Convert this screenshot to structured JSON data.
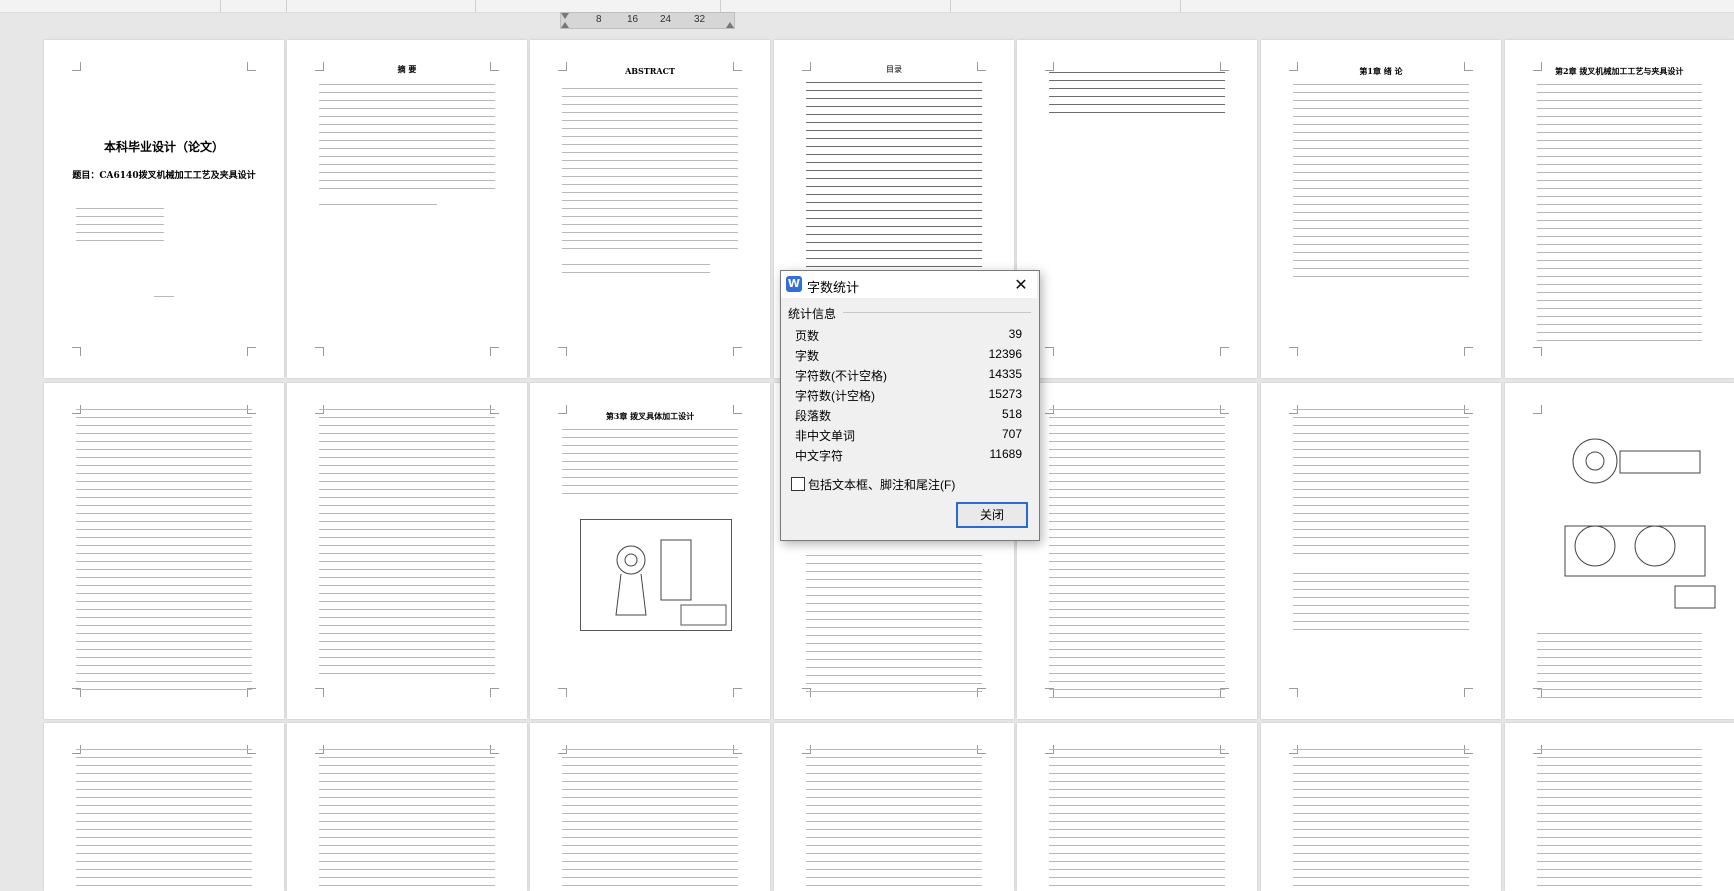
{
  "ruler": {
    "marks": [
      "8",
      "16",
      "24",
      "32"
    ]
  },
  "document": {
    "cover_title": "本科毕业设计（论文）",
    "cover_subject": "题目：CA6140拨叉机械加工工艺及夹具设计",
    "abstract_cn_title": "摘 要",
    "abstract_en_title": "ABSTRACT",
    "toc_title": "目录",
    "chapter1_title": "第1章 绪 论",
    "chapter2_title": "第2章 拨叉机械加工工艺与夹具设计",
    "chapter3_title": "第3章 拨叉具体加工设计"
  },
  "dialog": {
    "title": "字数统计",
    "section": "统计信息",
    "stats": [
      {
        "label": "页数",
        "value": "39"
      },
      {
        "label": "字数",
        "value": "12396"
      },
      {
        "label": "字符数(不计空格)",
        "value": "14335"
      },
      {
        "label": "字符数(计空格)",
        "value": "15273"
      },
      {
        "label": "段落数",
        "value": "518"
      },
      {
        "label": "非中文单词",
        "value": "707"
      },
      {
        "label": "中文字符",
        "value": "11689"
      }
    ],
    "checkbox_label": "包括文本框、脚注和尾注(F)",
    "checkbox_checked": false,
    "close_button": "关闭",
    "close_icon": "close-icon",
    "app_icon": "wps-writer-icon"
  }
}
